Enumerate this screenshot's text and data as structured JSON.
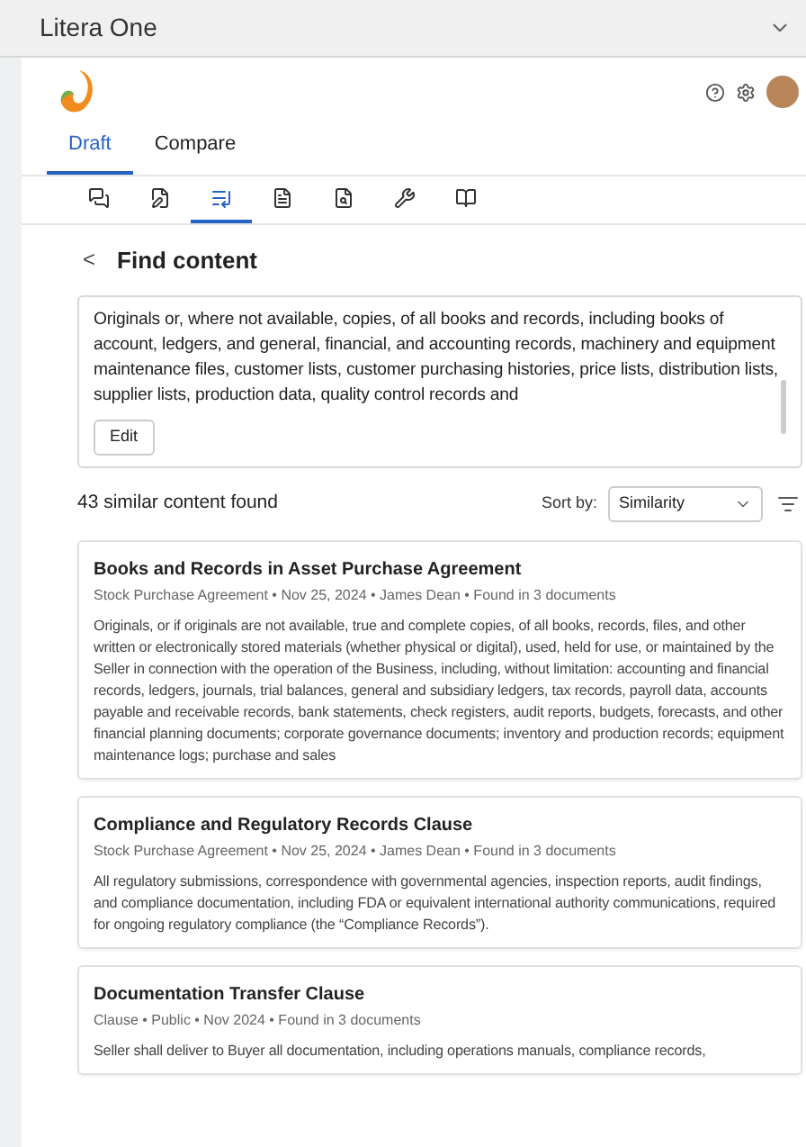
{
  "window": {
    "title": "Litera One"
  },
  "tabs": [
    {
      "label": "Draft",
      "selected": true
    },
    {
      "label": "Compare",
      "selected": false
    }
  ],
  "tools": [
    {
      "kind": "chat",
      "selected": false
    },
    {
      "kind": "doc-edit",
      "selected": false
    },
    {
      "kind": "list-edit",
      "selected": true
    },
    {
      "kind": "doc-text",
      "selected": false
    },
    {
      "kind": "doc-search",
      "selected": false
    },
    {
      "kind": "tools",
      "selected": false
    },
    {
      "kind": "book",
      "selected": false
    }
  ],
  "header": {
    "back": "<",
    "title": "Find content"
  },
  "query": {
    "text": "Originals or, where not available, copies, of all books and records, including books of account, ledgers, and general, financial, and accounting records, machinery and equipment maintenance files, customer lists, customer purchasing histories, price lists, distribution lists, supplier lists, production data, quality control records and",
    "edit_button": "Edit"
  },
  "results_count": "43 similar content found",
  "sort": {
    "label": "Sort by:",
    "value": "Similarity"
  },
  "results": [
    {
      "title": "Books and Records in Asset Purchase Agreement",
      "meta": "Stock Purchase Agreement • Nov 25, 2024 • James Dean • Found in 3 documents",
      "body": "Originals, or if originals are not available, true and complete copies, of all books, records, files, and other written or electronically stored materials (whether physical or digital), used, held for use, or maintained by the Seller in connection with the operation of the Business, including, without limitation: accounting and financial records, ledgers, journals, trial balances, general and subsidiary ledgers, tax records, payroll data, accounts payable and receivable records, bank statements, check registers, audit reports, budgets, forecasts, and other financial planning documents; corporate governance documents; inventory and production records; equipment maintenance logs; purchase and sales"
    },
    {
      "title": "Compliance and Regulatory Records Clause",
      "meta": "Stock Purchase Agreement • Nov 25, 2024 • James Dean • Found in 3 documents",
      "body": "All regulatory submissions, correspondence with governmental agencies, inspection reports, audit findings, and compliance documentation, including FDA or equivalent international authority communications, required for ongoing regulatory compliance (the “Compliance Records”)."
    },
    {
      "title": "Documentation Transfer Clause",
      "meta": "Clause • Public • Nov 2024 • Found in 3 documents",
      "body": "Seller shall deliver to Buyer all documentation, including operations manuals, compliance records,"
    }
  ]
}
